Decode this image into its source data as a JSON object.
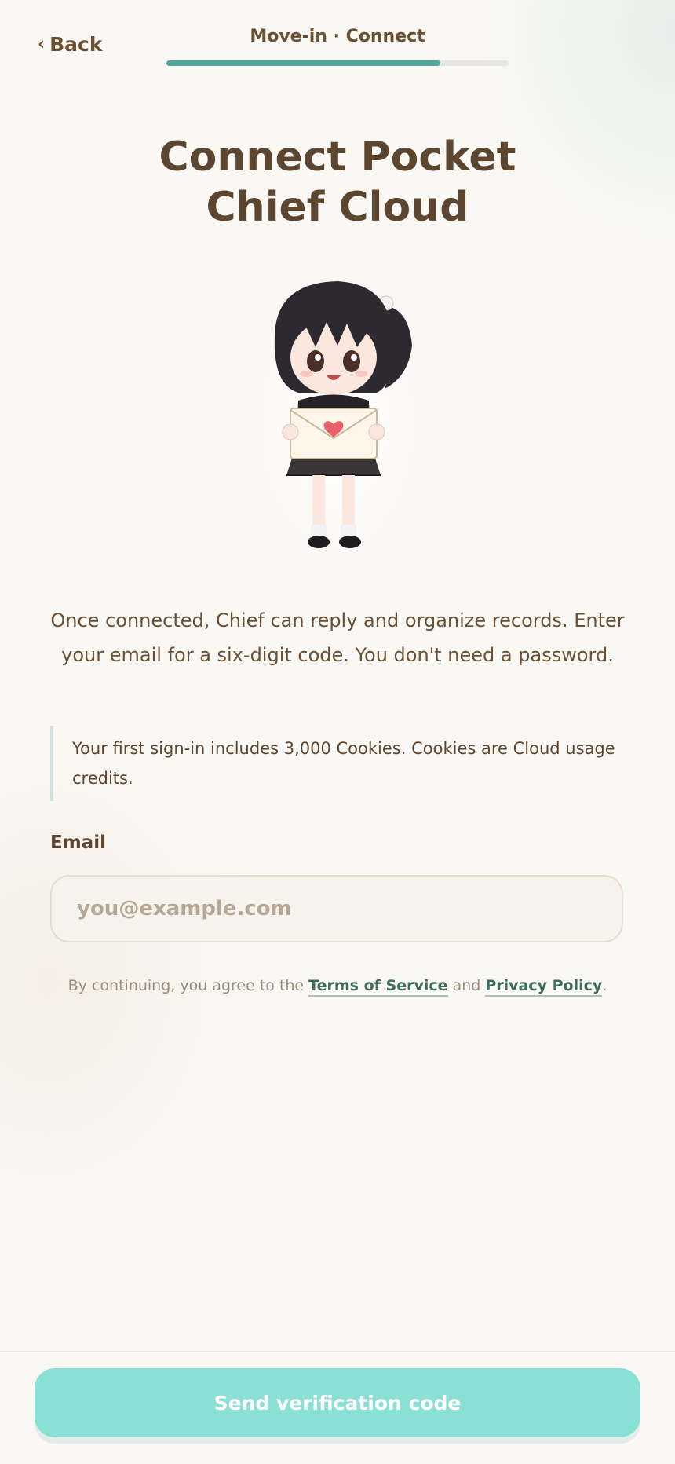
{
  "header": {
    "back_label": "Back",
    "step_label": "Move-in · Connect",
    "progress": 0.8
  },
  "title": {
    "line1": "Connect Pocket",
    "line2": "Chief Cloud"
  },
  "mascot": {
    "icon": "chibi-girl-holding-envelope-illustration"
  },
  "description": "Once connected, Chief can reply and organize records. Enter your email for a six-digit code. You don't need a password.",
  "note": "Your first sign-in includes 3,000 Cookies. Cookies are Cloud usage credits.",
  "email": {
    "label": "Email",
    "placeholder": "you@example.com",
    "value": ""
  },
  "terms": {
    "prefix": "By continuing, you agree to the ",
    "tos": "Terms of Service",
    "and": " and ",
    "privacy": "Privacy Policy",
    "suffix": "."
  },
  "send_button": "Send verification code",
  "colors": {
    "accent": "#4fa89b",
    "button": "#8be0d6",
    "text": "#5c4630"
  }
}
